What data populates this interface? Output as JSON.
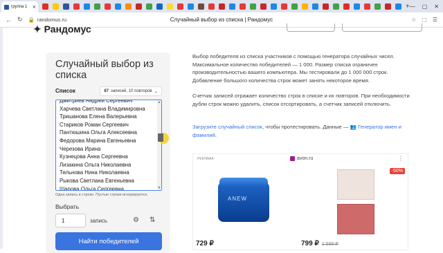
{
  "browser": {
    "active_tab": "группа 1",
    "tab_close": "✕",
    "new_tab": "+",
    "url": "randomus.ru",
    "page_title": "Случайный выбор из списка | Рандомус",
    "fav_colors": [
      "#d93025",
      "#ffcc00",
      "#2b579a",
      "#e53935",
      "#1e88e5",
      "#43a047",
      "#e53935",
      "#1e88e5",
      "#fb8c00",
      "#c62828",
      "#43a047",
      "#1565c0",
      "#fdd835",
      "#e53935",
      "#1e88e5",
      "#6d4c41",
      "#e53935",
      "#c62828",
      "#1e88e5",
      "#e53935",
      "#43a047",
      "#c62828",
      "#1e88e5",
      "#e53935",
      "#43a047",
      "#ffb300",
      "#1e88e5",
      "#c62828",
      "#43a047",
      "#d93025",
      "#1e88e5",
      "#e53935",
      "#43a047",
      "#c62828",
      "#1e88e5"
    ]
  },
  "site": {
    "logo": "Рандомус"
  },
  "generator": {
    "title": "Случайный выбор из списка",
    "list_label": "Список",
    "count_records": "87",
    "count_suffix": "записей, 10 повторов",
    "items": [
      "Дмитриев Андрей Сергеевич",
      "Харчева Светлана Владимировна",
      "Тришанова Елена Валерьевна",
      "Стариков Роман Сергеевич",
      "Пантюшина Ольга Алексеевна",
      "Федорова Марина Евгеньевна",
      "Черезова Ирина",
      "Кузнецова Анна Сергеевна",
      "Лизакина Ольга Николаевна",
      "Тельнова Нина Николаевна",
      "Рыкова Светлана Евгеньевна",
      "Шарова Ольга Сергеевна"
    ],
    "hint": "Одна запись в строке. Пустые строки игнорируются.",
    "pick_label": "Выбрать",
    "pick_count": "1",
    "pick_unit": "запись",
    "submit": "Найти победителей"
  },
  "description": {
    "p1": "Выбор победителя из списка участников с помощью генератора случайных чисел. Максимальное количество победителей — 1 000. Размер списка ограничен производительностью вашего компьютера. Мы тестировали до 1 000 000 строк. Добавление большого количества строк может занять некоторое время.",
    "p2": "Счетчик записей отражает количество строк в списке и их повторов. При необходимости дубли строк можно удалить, список отсортировать, а счетчик записей отключить.",
    "p3_link": "Загрузите случайный список",
    "p3_mid": ", чтобы протестировать. Данные —",
    "p3_link2": "Генератор имен и фамилий",
    "p3_end": "."
  },
  "ad": {
    "tag": "РЕКЛАМА",
    "domain": "avon.ru",
    "more": "⋮",
    "jar_brand": "ANEW",
    "sale": "-50%",
    "price1": "729 ₽",
    "price2": "799 ₽",
    "price2_old": "1 599 ₽"
  }
}
